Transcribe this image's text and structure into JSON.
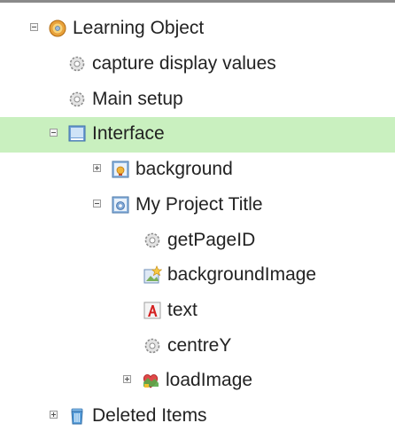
{
  "tree": {
    "nodes": [
      {
        "label": "Learning Object",
        "icon": "learning-object-icon",
        "toggle": "collapse"
      },
      {
        "label": "capture display values",
        "icon": "gear-script-icon",
        "toggle": "none"
      },
      {
        "label": "Main setup",
        "icon": "gear-script-icon",
        "toggle": "none"
      },
      {
        "label": "Interface",
        "icon": "interface-page-icon",
        "toggle": "collapse",
        "selected": true
      },
      {
        "label": "background",
        "icon": "background-page-icon",
        "toggle": "expand"
      },
      {
        "label": "My Project Title",
        "icon": "project-title-page-icon",
        "toggle": "collapse"
      },
      {
        "label": "getPageID",
        "icon": "gear-script-icon",
        "toggle": "none"
      },
      {
        "label": "backgroundImage",
        "icon": "image-star-icon",
        "toggle": "none"
      },
      {
        "label": "text",
        "icon": "text-icon",
        "toggle": "none"
      },
      {
        "label": "centreY",
        "icon": "gear-script-icon",
        "toggle": "none"
      },
      {
        "label": "loadImage",
        "icon": "load-image-icon",
        "toggle": "expand"
      },
      {
        "label": "Deleted Items",
        "icon": "deleted-items-icon",
        "toggle": "expand"
      }
    ]
  },
  "colors": {
    "selected_background": "#c9f0bf",
    "text": "#222222"
  }
}
